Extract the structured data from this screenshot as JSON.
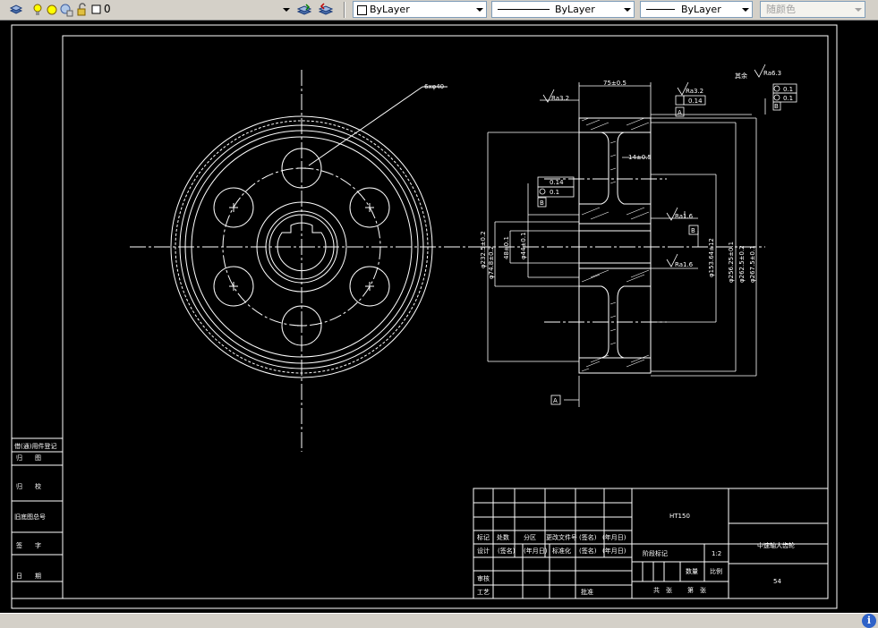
{
  "toolbar": {
    "layer_name": "0",
    "linetype_label": "ByLayer",
    "lineweight_label": "ByLayer",
    "linetype2_label": "ByLayer",
    "plotstyle_label": "随颜色",
    "layer_icons": [
      "layer-manager-icon",
      "lightbulb-icon",
      "sun-icon",
      "freeze-viewport-icon",
      "lock-icon",
      "color-swatch-icon"
    ],
    "colors": {
      "bg": "#d4d0c8",
      "lightbulb": "#ffff00",
      "sun": "#ffff00"
    }
  },
  "drawing": {
    "labels": {
      "hole_callout": "6xφ40",
      "width_dim": "75±0.5",
      "rough_left": "Ra3.2",
      "rough_top": "Ra3.2",
      "runout_top": "0.14",
      "datum_A": "A",
      "datum_B": "B",
      "other_surface": "其余",
      "rough_other": "Ra6.3",
      "flat_1": "0.1",
      "flat_2": "0.1",
      "web_width": "14±0.5",
      "runout_mid": "0.14",
      "circ_mid": "0.1",
      "rough_bore_top": "Ra1.6",
      "rough_bore_bot": "Ra1.6",
      "dia_232": "φ232.5±0.2",
      "dia_74": "φ74.8±0.2",
      "dia_48": "48±0.1",
      "dia_44": "φ44±0.1",
      "dia_153": "φ153.64±12",
      "dia_256": "φ256.25±0.1",
      "dia_262": "φ262.5±0.2",
      "dia_267": "φ267.5±0.1"
    },
    "colors": {
      "line": "#ffffff",
      "bg": "#000000"
    }
  },
  "left_strip": {
    "rows": [
      "借(通)用件登记",
      "归　　图",
      "归　　校",
      "旧底图总号",
      "签　　字",
      "日　　期"
    ]
  },
  "title_block": {
    "material": "HT150",
    "part_name": "中速轴大齿轮",
    "page_no": "54",
    "scale": "1:2",
    "stage_mark": "阶段标记",
    "weight_label": "数量",
    "ratio_label": "比例",
    "sheets_total": "共　张",
    "sheet_no": "第　张",
    "rev_headers": [
      "标记",
      "处数",
      "分区",
      "更改文件号",
      "(签名)",
      "(年月日)"
    ],
    "design_row": [
      "设计",
      "(签名)",
      "(年月日)",
      "标准化",
      "(签名)",
      "(年月日)"
    ],
    "review": "审核",
    "process": "工艺",
    "approve": "批准"
  }
}
